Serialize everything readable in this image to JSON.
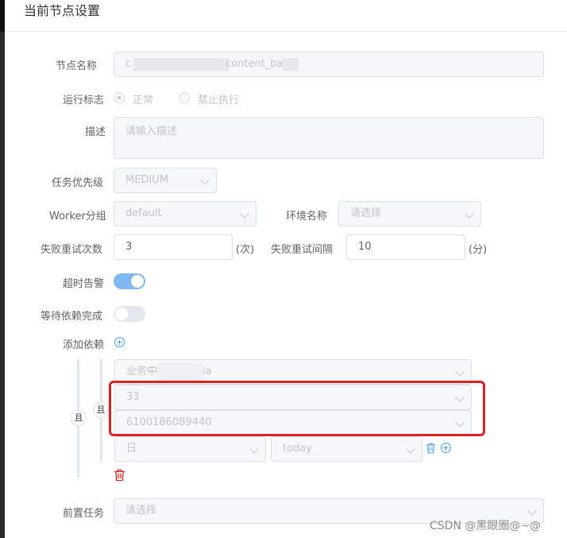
{
  "header": {
    "title": "当前节点设置"
  },
  "form": {
    "node_name": {
      "label": "节点名称",
      "value_start": "c",
      "value_mid": "content_ba"
    },
    "run_flag": {
      "label": "运行标志",
      "option_normal": "正常",
      "option_disabled": "禁止执行",
      "selected": "正常"
    },
    "description": {
      "label": "描述",
      "placeholder": "请输入描述"
    },
    "priority": {
      "label": "任务优先级",
      "value": "MEDIUM"
    },
    "worker_group": {
      "label": "Worker分组",
      "value": "default"
    },
    "env_name": {
      "label": "环境名称",
      "placeholder": "请选择"
    },
    "retry_times": {
      "label": "失败重试次数",
      "value": "3",
      "unit": "(次)"
    },
    "retry_interval": {
      "label": "失败重试间隔",
      "value": "10",
      "unit": "(分)"
    },
    "timeout_alarm": {
      "label": "超时告警",
      "on": true
    },
    "wait_dependency": {
      "label": "等待依赖完成",
      "on": false
    },
    "add_dependency": {
      "label": "添加依赖"
    },
    "dependency": {
      "outer_relation": "且",
      "inner_relation": "且",
      "project": "业务中",
      "project_suffix": "ia",
      "workflow": "33",
      "task": "6100186089440",
      "cycle": "日",
      "date": "today"
    },
    "pre_task": {
      "label": "前置任务",
      "placeholder": "请选择"
    }
  },
  "watermark": "CSDN @黑眼圈@~@",
  "colors": {
    "accent": "#409eff",
    "highlight_border": "#e02020",
    "danger": "#e02020"
  }
}
